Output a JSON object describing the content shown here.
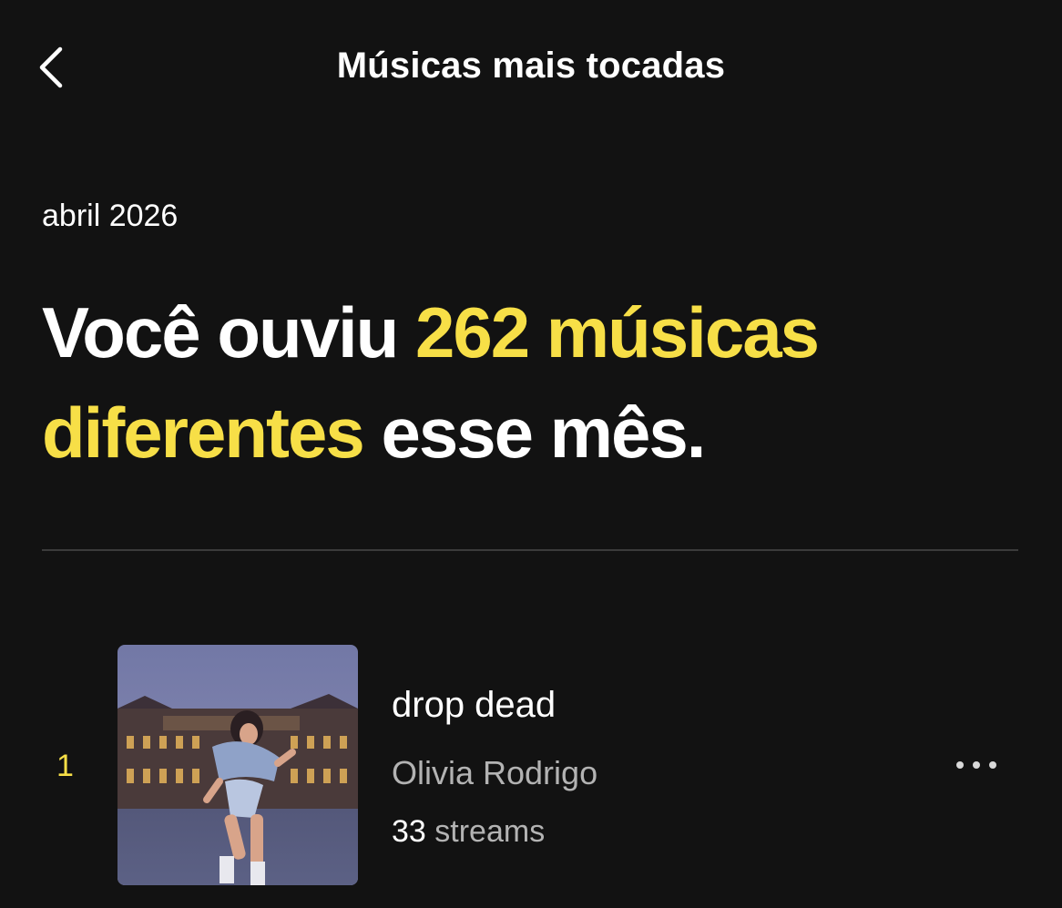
{
  "header": {
    "title": "Músicas mais tocadas"
  },
  "summary": {
    "period": "abril 2026",
    "headline_before": "Você ouviu ",
    "headline_highlight": "262 músicas diferentes",
    "headline_after": " esse mês."
  },
  "tracks": [
    {
      "rank": "1",
      "title": "drop dead",
      "artist": "Olivia Rodrigo",
      "streams_count": "33",
      "streams_unit": "streams"
    }
  ],
  "icons": {
    "back": "chevron-left-icon",
    "more": "more-horizontal-icon"
  },
  "colors": {
    "background": "#121212",
    "accent": "#f7df47",
    "text_primary": "#ffffff",
    "text_secondary": "#b3b3b3",
    "divider": "#3b3b3b"
  }
}
